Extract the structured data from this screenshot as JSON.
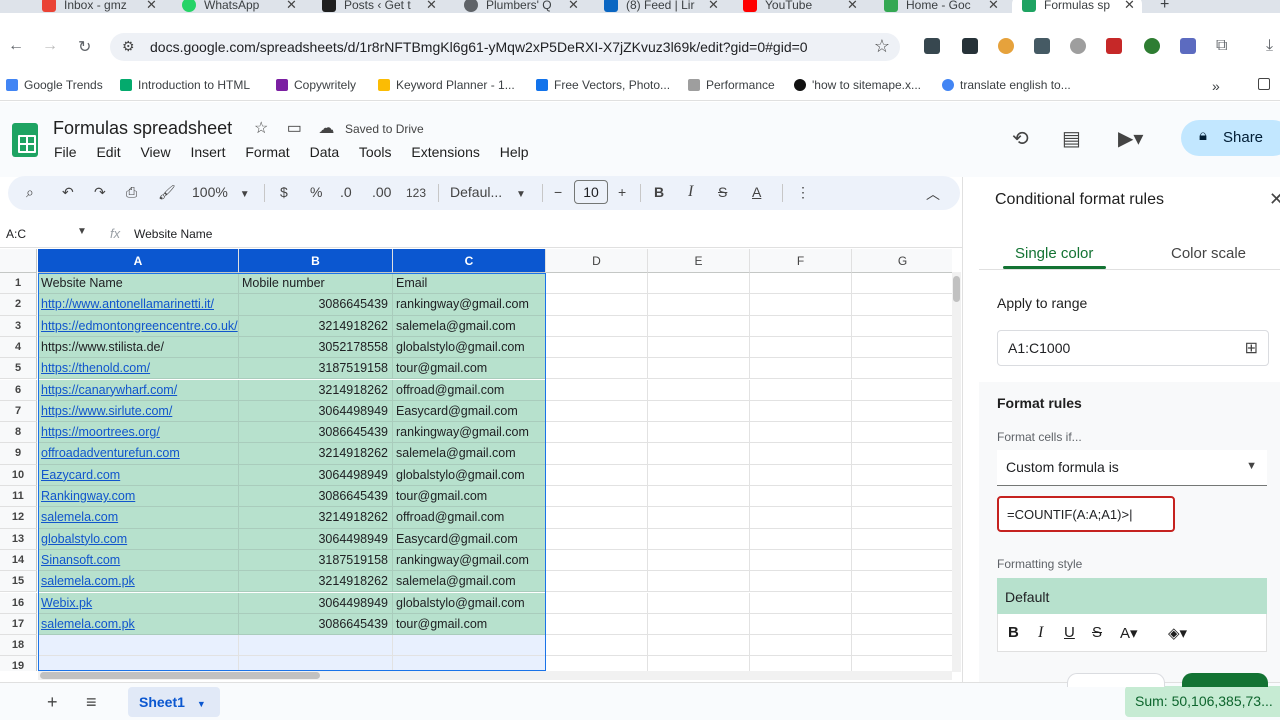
{
  "browser": {
    "tabs": [
      {
        "title": "Inbox - gmz",
        "color": "#ea4335"
      },
      {
        "title": "WhatsApp",
        "color": "#25d366"
      },
      {
        "title": "Posts ‹ Get t",
        "color": "#1f1f1f"
      },
      {
        "title": "Plumbers' Q",
        "color": "#5f6368"
      },
      {
        "title": "(8) Feed | Lir",
        "color": "#0a66c2"
      },
      {
        "title": "YouTube",
        "color": "#ff0000"
      },
      {
        "title": "Home - Goc",
        "color": "#34a853"
      },
      {
        "title": "Formulas sp",
        "color": "#1ea362"
      }
    ],
    "url": "docs.google.com/spreadsheets/d/1r8rNFTBmgKl6g61-yMqw2xP5DeRXI-X7jZKvuz3l69k/edit?gid=0#gid=0",
    "bookmarks": [
      "Google Trends",
      "Introduction to HTML",
      "Copywritely",
      "Keyword Planner - 1...",
      "Free Vectors, Photo...",
      "Performance",
      "'how to sitemape.x...",
      "translate english to..."
    ]
  },
  "app": {
    "title": "Formulas spreadsheet",
    "saved_status": "Saved to Drive",
    "menu": [
      "File",
      "Edit",
      "View",
      "Insert",
      "Format",
      "Data",
      "Tools",
      "Extensions",
      "Help"
    ],
    "share_label": "Share",
    "accent": "#137333"
  },
  "toolbar": {
    "zoom": "100%",
    "currency": "$",
    "percent": "%",
    "dec_decrease": ".0",
    "dec_increase": ".00",
    "number_format": "123",
    "font": "Defaul...",
    "font_size": "10"
  },
  "formula_bar": {
    "name_box": "A:C",
    "value": "Website Name"
  },
  "sheet": {
    "columns": [
      "A",
      "B",
      "C",
      "D",
      "E",
      "F",
      "G"
    ],
    "rows": [
      {
        "n": "1",
        "a": "Website Name",
        "b": "Mobile number",
        "c": "Email",
        "link": false
      },
      {
        "n": "2",
        "a": "http://www.antonellamarinetti.it/",
        "b": "3086645439",
        "c": "rankingway@gmail.com",
        "link": true
      },
      {
        "n": "3",
        "a": "https://edmontongreencentre.co.uk/",
        "b": "3214918262",
        "c": "salemela@gmail.com",
        "link": true
      },
      {
        "n": "4",
        "a": "https://www.stilista.de/",
        "b": "3052178558",
        "c": "globalstylo@gmail.com",
        "link": false
      },
      {
        "n": "5",
        "a": "https://thenold.com/",
        "b": "3187519158",
        "c": "tour@gmail.com",
        "link": true
      },
      {
        "n": "6",
        "a": "https://canarywharf.com/",
        "b": "3214918262",
        "c": "offroad@gmail.com",
        "link": true
      },
      {
        "n": "7",
        "a": "https://www.sirlute.com/",
        "b": "3064498949",
        "c": "Easycard@gmail.com",
        "link": true
      },
      {
        "n": "8",
        "a": "https://moortrees.org/",
        "b": "3086645439",
        "c": "rankingway@gmail.com",
        "link": true
      },
      {
        "n": "9",
        "a": "offroadadventurefun.com",
        "b": "3214918262",
        "c": "salemela@gmail.com",
        "link": true
      },
      {
        "n": "10",
        "a": "Eazycard.com",
        "b": "3064498949",
        "c": "globalstylo@gmail.com",
        "link": true
      },
      {
        "n": "11",
        "a": "Rankingway.com",
        "b": "3086645439",
        "c": "tour@gmail.com",
        "link": true
      },
      {
        "n": "12",
        "a": "salemela.com",
        "b": "3214918262",
        "c": "offroad@gmail.com",
        "link": true
      },
      {
        "n": "13",
        "a": "globalstylo.com",
        "b": "3064498949",
        "c": "Easycard@gmail.com",
        "link": true
      },
      {
        "n": "14",
        "a": "Sinansoft.com",
        "b": "3187519158",
        "c": "rankingway@gmail.com",
        "link": true
      },
      {
        "n": "15",
        "a": "salemela.com.pk",
        "b": "3214918262",
        "c": "salemela@gmail.com",
        "link": true
      },
      {
        "n": "16",
        "a": "Webix.pk",
        "b": "3064498949",
        "c": "globalstylo@gmail.com",
        "link": true
      },
      {
        "n": "17",
        "a": "salemela.com.pk",
        "b": "3086645439",
        "c": "tour@gmail.com",
        "link": true
      },
      {
        "n": "18",
        "a": "",
        "b": "",
        "c": "",
        "link": false
      },
      {
        "n": "19",
        "a": "",
        "b": "",
        "c": "",
        "link": false
      }
    ],
    "highlight_color": "#b7e1cd",
    "sheet_tab": "Sheet1",
    "sum_label": "Sum: 50,106,385,73..."
  },
  "panel": {
    "title": "Conditional format rules",
    "tab_single": "Single color",
    "tab_scale": "Color scale",
    "apply_label": "Apply to range",
    "range": "A1:C1000",
    "format_rules_label": "Format rules",
    "format_cells_if": "Format cells if...",
    "condition": "Custom formula is",
    "formula": "=COUNTIF(A:A;A1)>",
    "formatting_style_label": "Formatting style",
    "style_preview": "Default"
  }
}
